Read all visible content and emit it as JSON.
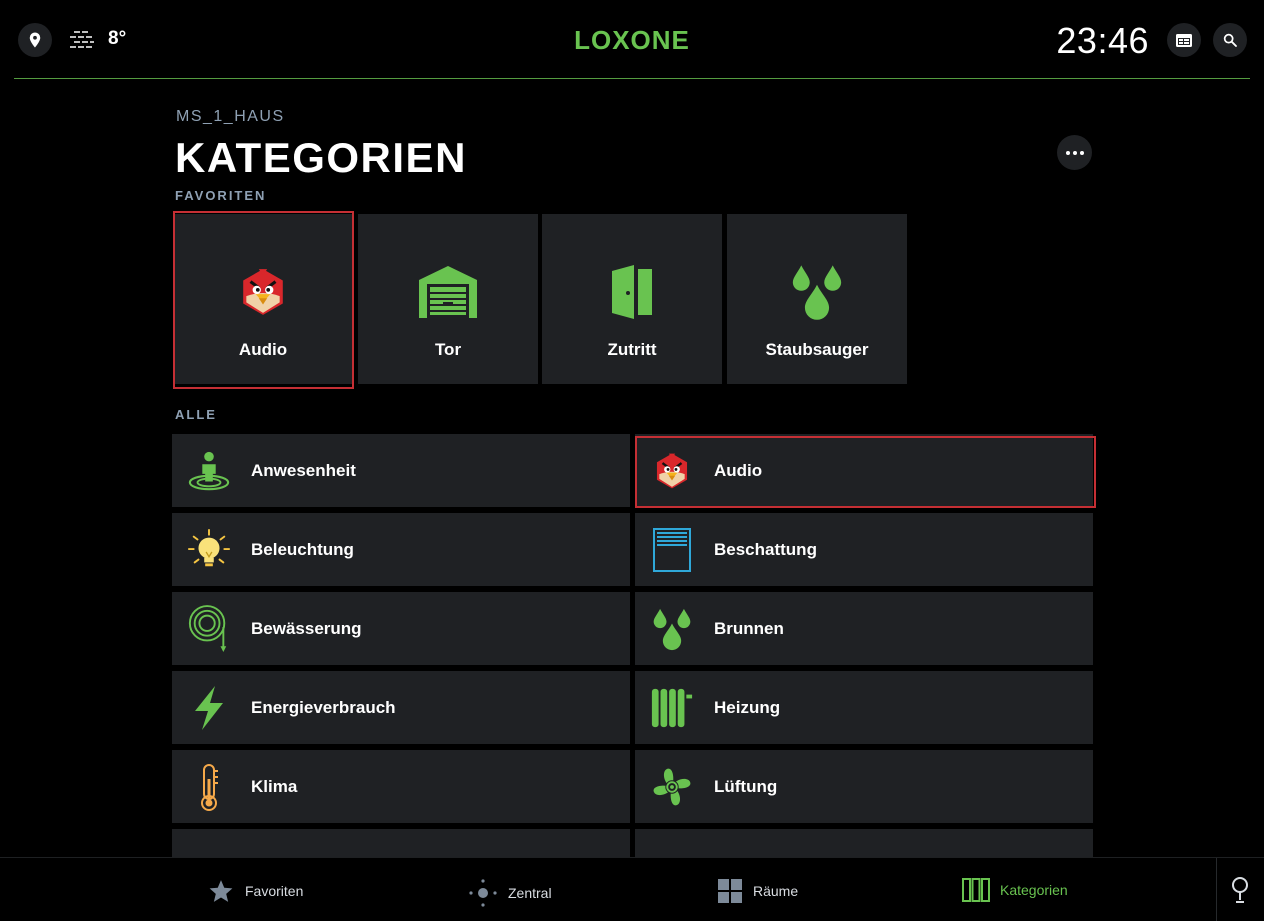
{
  "header": {
    "logo": "LOXONE",
    "temperature": "8°",
    "time": "23:46",
    "location_icon": "location-pin-icon",
    "weather_icon": "fog-icon",
    "calendar_icon": "calendar-icon",
    "search_icon": "search-icon"
  },
  "page": {
    "breadcrumb": "MS_1_HAUS",
    "title": "KATEGORIEN",
    "favorites_label": "FAVORITEN",
    "all_label": "ALLE"
  },
  "favorites": [
    {
      "label": "Audio",
      "icon": "angry-bird-icon",
      "selected": true
    },
    {
      "label": "Tor",
      "icon": "garage-icon"
    },
    {
      "label": "Zutritt",
      "icon": "door-icon"
    },
    {
      "label": "Staubsauger",
      "icon": "drops-icon"
    }
  ],
  "categories": [
    {
      "label": "Anwesenheit",
      "icon": "presence-icon"
    },
    {
      "label": "Audio",
      "icon": "angry-bird-icon",
      "selected": true
    },
    {
      "label": "Beleuchtung",
      "icon": "bulb-icon"
    },
    {
      "label": "Beschattung",
      "icon": "blinds-icon"
    },
    {
      "label": "Bewässerung",
      "icon": "hose-icon"
    },
    {
      "label": "Brunnen",
      "icon": "drops-icon"
    },
    {
      "label": "Energieverbrauch",
      "icon": "lightning-icon"
    },
    {
      "label": "Heizung",
      "icon": "radiator-icon"
    },
    {
      "label": "Klima",
      "icon": "thermometer-icon"
    },
    {
      "label": "Lüftung",
      "icon": "fan-icon"
    }
  ],
  "nav": {
    "favorites": "Favoriten",
    "central": "Zentral",
    "rooms": "Räume",
    "categories": "Kategorien"
  },
  "colors": {
    "accent": "#69c350",
    "selection": "#c52f34",
    "tile": "#1f2124",
    "muted": "#8fa1b4"
  }
}
